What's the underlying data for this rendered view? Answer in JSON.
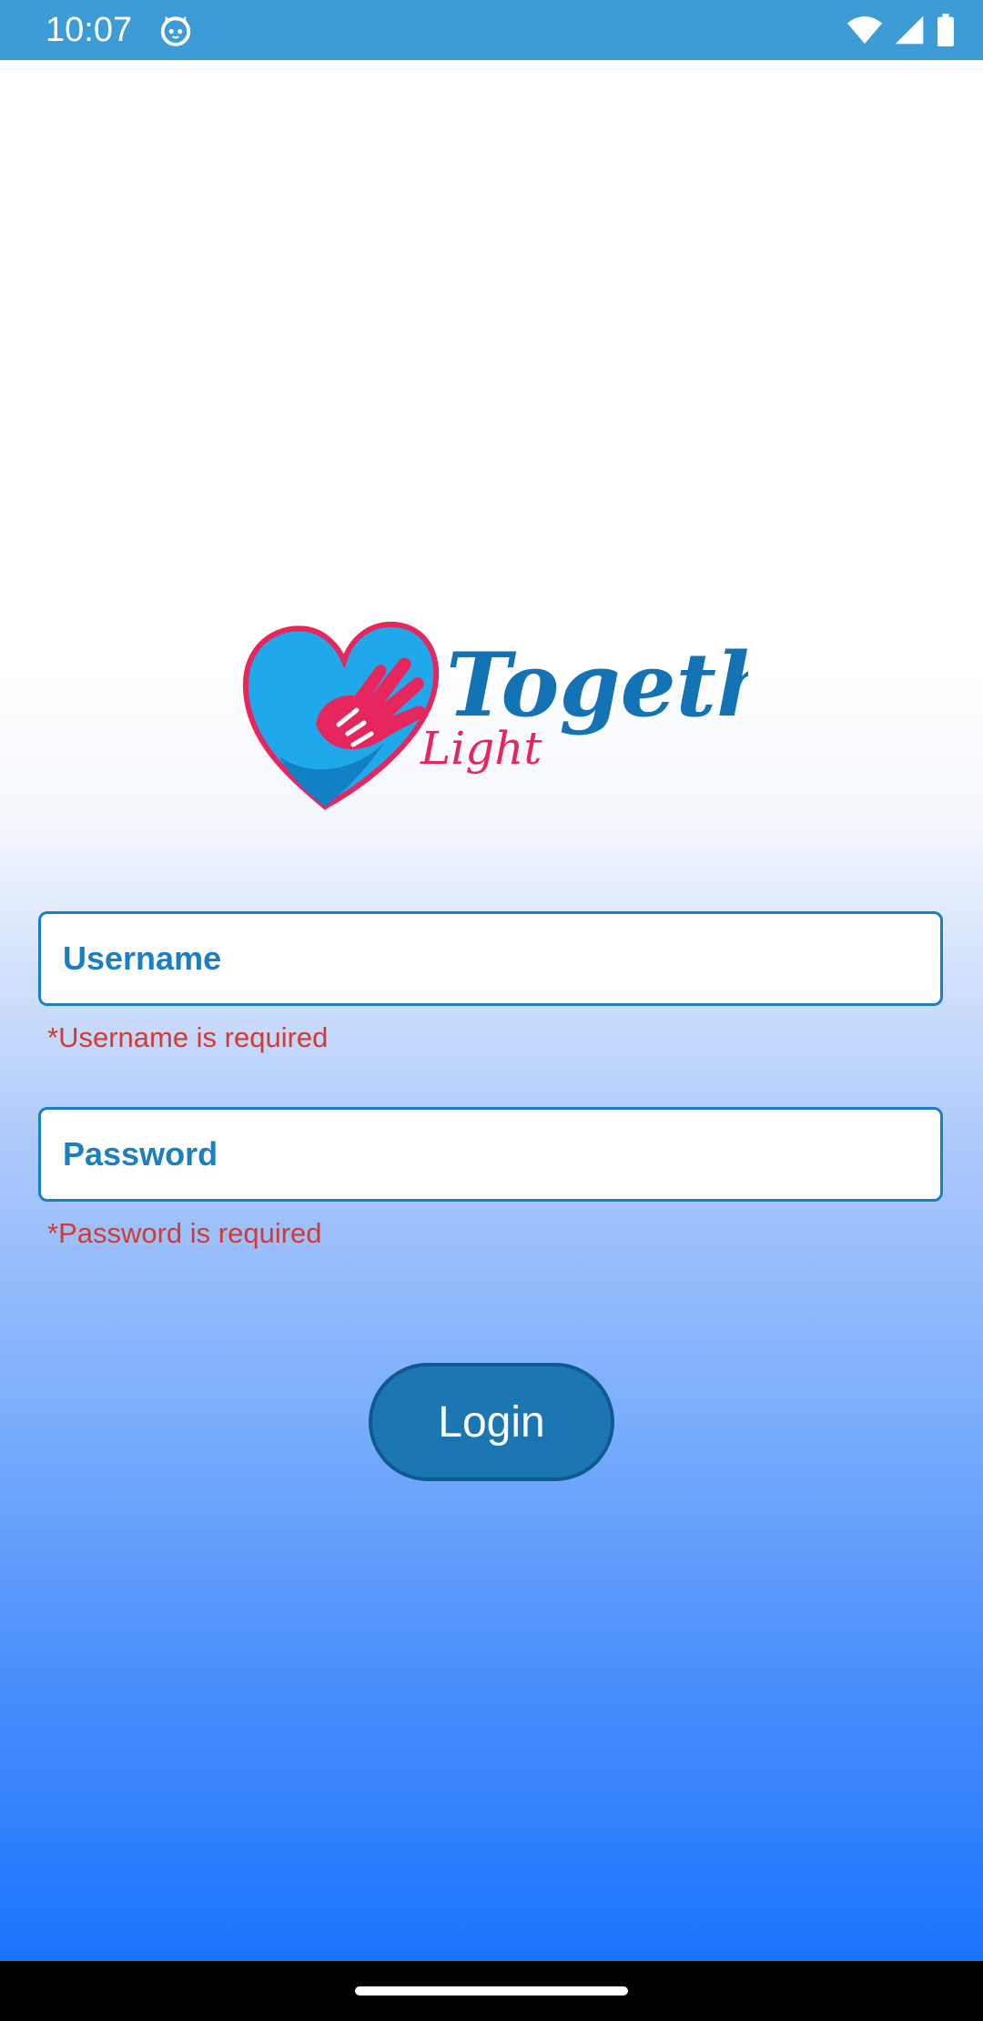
{
  "status_bar": {
    "time": "10:07",
    "notification_icon": "cat-face-icon",
    "icons": [
      "wifi-icon",
      "cell-signal-icon",
      "battery-icon"
    ]
  },
  "logo": {
    "wordmark": "Together",
    "sub_wordmark": "Light",
    "icon": "heart-hand-icon"
  },
  "form": {
    "username": {
      "placeholder": "Username",
      "value": "",
      "error": "*Username is required"
    },
    "password": {
      "placeholder": "Password",
      "value": "",
      "error": "*Password is required"
    },
    "login_label": "Login"
  },
  "colors": {
    "status_bar": "#3d9bd6",
    "accent": "#1b7fc1",
    "error": "#d43b30",
    "button": "#1b76b2",
    "logo_pink": "#e8265e",
    "gradient_bottom": "#1a73fc"
  }
}
